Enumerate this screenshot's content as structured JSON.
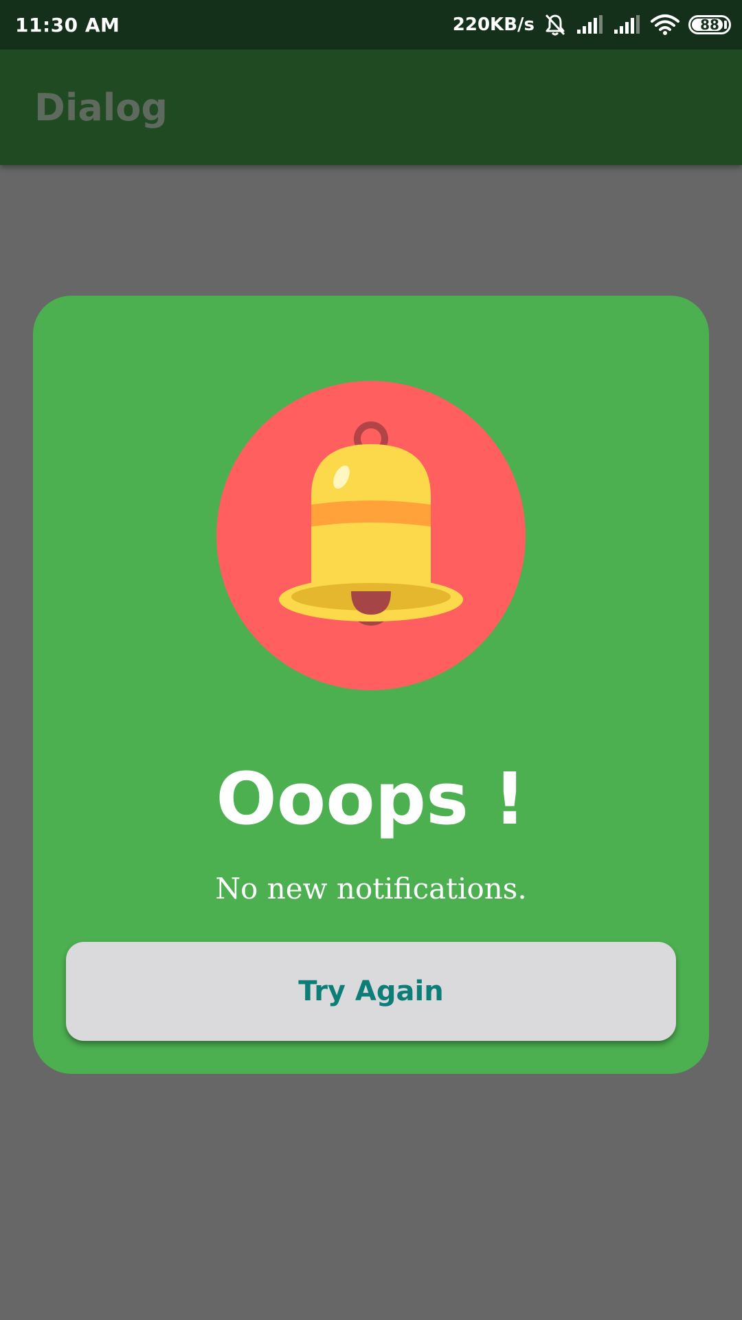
{
  "status_bar": {
    "time": "11:30 AM",
    "network_speed": "220KB/s",
    "battery_level": "88",
    "icons": [
      "mute-bell-icon",
      "signal-icon",
      "signal-icon",
      "wifi-icon",
      "battery-icon"
    ]
  },
  "app_bar": {
    "title": "Dialog"
  },
  "dialog": {
    "icon": "bell-icon",
    "title": "Ooops !",
    "message": "No new notifications.",
    "button_label": "Try Again"
  },
  "colors": {
    "status_bar_bg": "#15301a",
    "app_bar_bg": "#1f4a22",
    "overlay_bg": "#676767",
    "dialog_bg": "#4caf50",
    "icon_circle": "#ff5f5f",
    "bell_yellow": "#fcd94a",
    "bell_band": "#ffa23a",
    "button_bg": "#dadadc",
    "button_text": "#0d7d78"
  }
}
